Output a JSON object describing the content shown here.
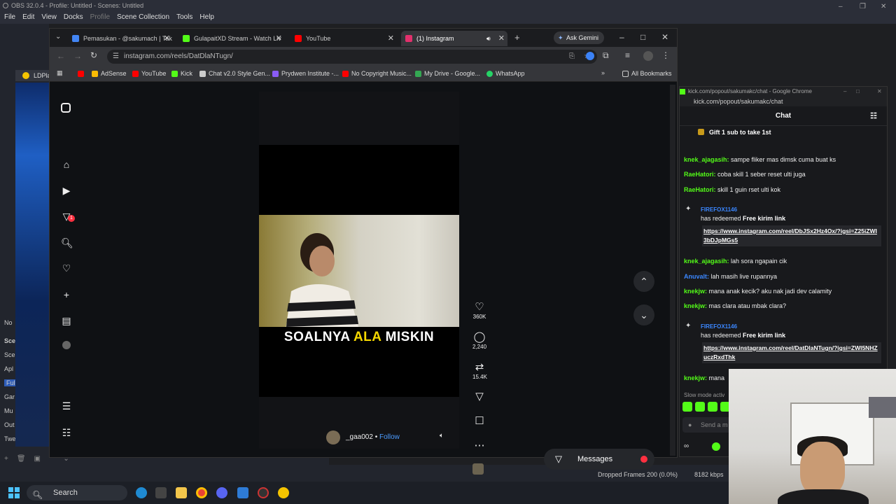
{
  "obs": {
    "title": "OBS 32.0.4 - Profile: Untitled - Scenes: Untitled",
    "menu": [
      "File",
      "Edit",
      "View",
      "Docks",
      "Profile",
      "Scene Collection",
      "Tools",
      "Help"
    ],
    "ldplayer_tab": "LDPla",
    "dock_labels": [
      "No",
      "Sce",
      "Sce",
      "Apl",
      "Full",
      "Gar",
      "Mu",
      "Out",
      "Twe"
    ],
    "status": {
      "dropped_frames": "Dropped Frames 200 (0.0%)",
      "bitrate": "8182 kbps"
    }
  },
  "taskbar": {
    "search_label": "Search"
  },
  "chrome": {
    "tabs": [
      {
        "label": "Pemasukan - @sakumach | Tak",
        "color": "#4285f4"
      },
      {
        "label": "GulapaitXD Stream - Watch Liv",
        "color": "#53fc18"
      },
      {
        "label": "YouTube",
        "color": "#ff0000"
      },
      {
        "label": "(1) Instagram",
        "color": "#e1306c"
      }
    ],
    "ask_gemini": "Ask Gemini",
    "url": "instagram.com/reels/DatDlaNTugn/",
    "bookmarks": [
      {
        "label": "AdSense",
        "color": "#fbbc04"
      },
      {
        "label": "YouTube",
        "color": "#ff0000"
      },
      {
        "label": "Kick",
        "color": "#53fc18"
      },
      {
        "label": "Chat v2.0 Style Gen...",
        "color": "#cccccc"
      },
      {
        "label": "Prydwen Institute -...",
        "color": "#8a5cf6"
      },
      {
        "label": "No Copyright Music...",
        "color": "#ff0000"
      },
      {
        "label": "My Drive - Google...",
        "color": "#34a853"
      },
      {
        "label": "WhatsApp",
        "color": "#25d366"
      }
    ],
    "all_bookmarks": "All Bookmarks"
  },
  "instagram": {
    "caption_pre": "SOALNYA ",
    "caption_highlight": "ALA",
    "caption_post": " MISKIN",
    "username": "_gaa002",
    "follow": "Follow",
    "likes": "360K",
    "comments": "2,240",
    "reposts": "15.4K",
    "messages": "Messages",
    "notif_badge": "1"
  },
  "kick": {
    "window_title": "kick.com/popout/sakumakc/chat - Google Chrome",
    "url": "kick.com/popout/sakumakc/chat",
    "header": "Chat",
    "gift": "Gift 1 sub to take 1st",
    "messages": [
      {
        "user": "knek_ajagasih:",
        "text": " sampe fliker mas dimsk cuma buat ks",
        "color": "#53fc18"
      },
      {
        "user": "RaeHatori:",
        "text": " coba skill 1 seber reset ulti juga",
        "color": "#53fc18"
      },
      {
        "user": "RaeHatori:",
        "text": " skill 1 guin rset ulti kok",
        "color": "#53fc18"
      },
      {
        "user": "knek_ajagasih:",
        "text": " lah sora ngapain cik",
        "color": "#53fc18"
      },
      {
        "user": "Anuvalt:",
        "text": " lah masih live rupannya",
        "color": "#3b87ff"
      },
      {
        "user": "knekjw:",
        "text": " mana anak kecik? aku nak jadi dev calamity",
        "color": "#53fc18"
      },
      {
        "user": "knekjw:",
        "text": " mas clara atau mbak clara?",
        "color": "#53fc18"
      },
      {
        "user": "knekjw:",
        "text": " mana",
        "color": "#53fc18"
      }
    ],
    "redeems": [
      {
        "user": "FIREFOX1146",
        "action_pre": "has redeemed ",
        "action": "Free kirim link",
        "link": "https://www.instagram.com/reel/DbJSx2Hz4Ox/?igsi=Z25iZWI3bDJpMGs5"
      },
      {
        "user": "FIREFOX1146",
        "action_pre": "has redeemed ",
        "action": "Free kirim link",
        "link": "https://www.instagram.com/reel/DatDlaNTugn/?igsi=ZWI5NHZuczRxdThk"
      }
    ],
    "slow_mode": "Slow mode activ",
    "input_placeholder": "Send a m"
  }
}
